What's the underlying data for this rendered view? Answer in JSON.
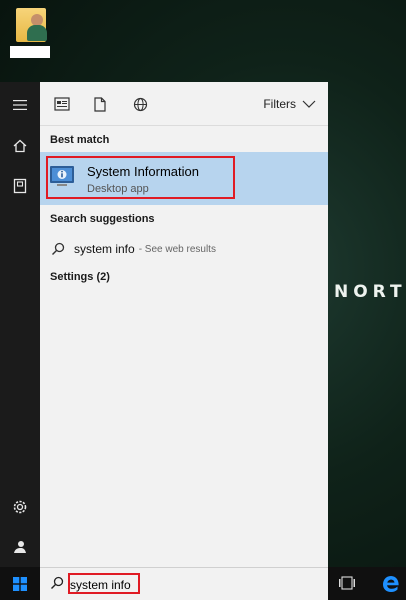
{
  "desktop": {
    "icon_name": "user-folder-icon",
    "brand_text": "NORT"
  },
  "sidebar": {
    "items": [
      {
        "name": "hamburger-menu-icon"
      },
      {
        "name": "home-icon"
      },
      {
        "name": "documents-icon"
      },
      {
        "name": "settings-gear-icon"
      },
      {
        "name": "user-account-icon"
      }
    ]
  },
  "toolbar": {
    "buttons": [
      "apps-filter-icon",
      "documents-filter-icon",
      "web-filter-icon"
    ],
    "filters_label": "Filters"
  },
  "results": {
    "best_match_title": "Best match",
    "best_match": {
      "title": "System Information",
      "subtitle": "Desktop app",
      "icon": "system-information-icon"
    },
    "search_suggestions_title": "Search suggestions",
    "suggestion": {
      "text": "system info",
      "see_results": "- See web results"
    },
    "settings_title": "Settings (2)"
  },
  "taskbar": {
    "search_value": "system info",
    "icons": [
      "windows-start-icon",
      "search-icon",
      "task-view-icon",
      "edge-browser-icon"
    ]
  },
  "colors": {
    "accent_blue": "#0078d7",
    "selected_bg": "#b7d4ee",
    "annotation_red": "#e01b24",
    "sidebar_bg": "#1b1b1b"
  }
}
